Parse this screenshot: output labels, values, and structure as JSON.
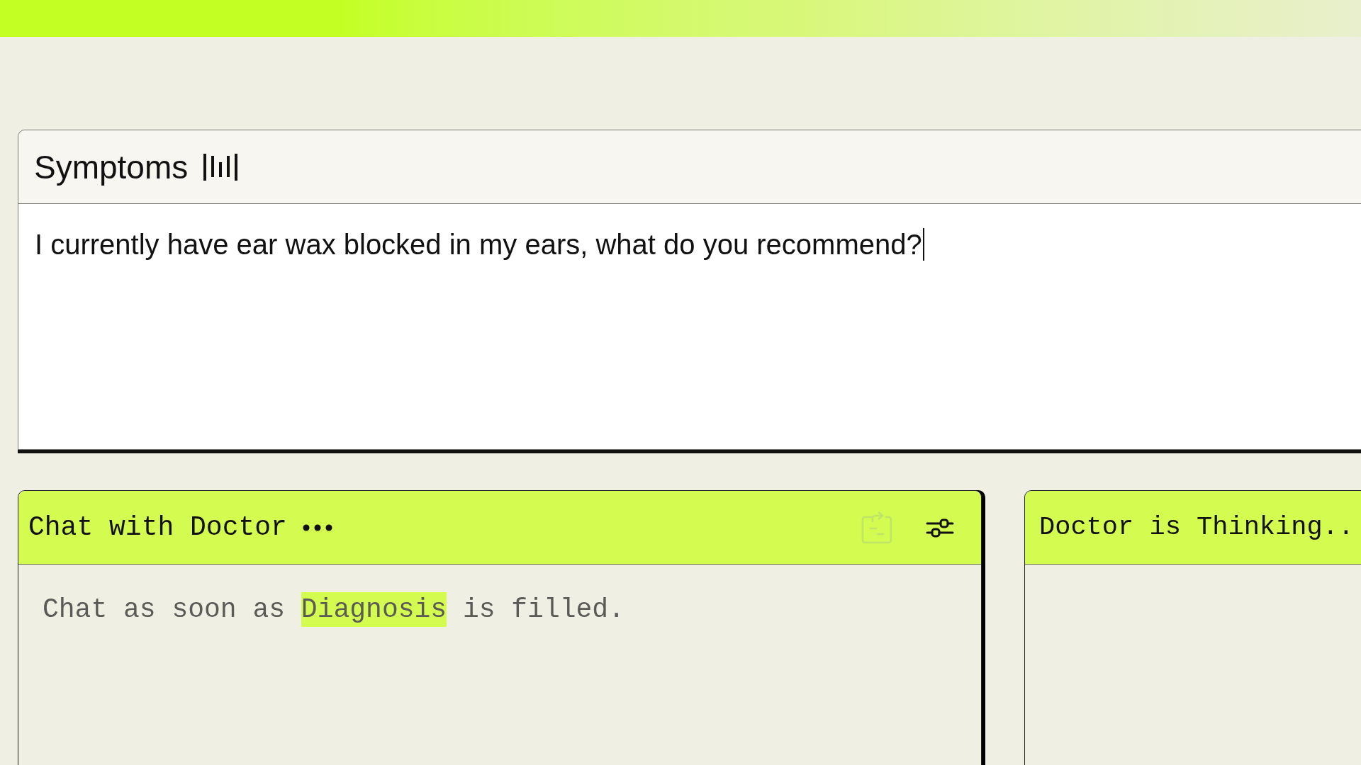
{
  "symptoms": {
    "title": "Symptoms",
    "value": "I currently have ear wax blocked in my ears, what do you recommend?",
    "focused": true
  },
  "chat_panel": {
    "title": "Chat with Doctor",
    "actions": [
      {
        "kind": "transfer",
        "disabled": true
      },
      {
        "kind": "settings",
        "disabled": false
      }
    ],
    "notice": [
      {
        "text": "Chat as soon as ",
        "highlight": false
      },
      {
        "text": "Diagnosis",
        "highlight": true
      },
      {
        "text": " is filled.",
        "highlight": false
      }
    ]
  },
  "thinking_panel": {
    "title": "Doctor is Thinking.."
  }
}
